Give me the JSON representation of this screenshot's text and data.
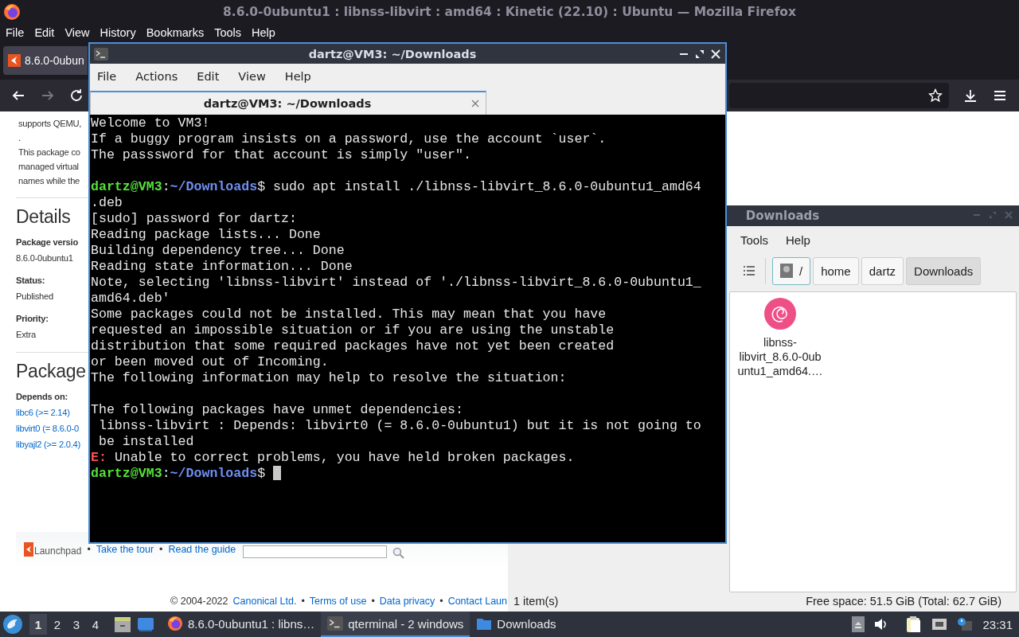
{
  "firefox": {
    "title": "8.6.0-0ubuntu1 : libnss-libvirt : amd64 : Kinetic (22.10) : Ubuntu — Mozilla Firefox",
    "menu": [
      "File",
      "Edit",
      "View",
      "History",
      "Bookmarks",
      "Tools",
      "Help"
    ],
    "tabs": [
      {
        "label": "8.6.0-0ubun",
        "selected": true
      }
    ],
    "page": {
      "intro": [
        "supports QEMU,",
        ".",
        "This package co",
        "managed virtual",
        "names while the"
      ],
      "details_heading": "Details",
      "details": [
        {
          "label": "Package versio",
          "value": "8.6.0-0ubuntu1"
        },
        {
          "label": "Status:",
          "value": "Published"
        },
        {
          "label": "Priority:",
          "value": "Extra"
        }
      ],
      "package_heading": "Package",
      "depends_label": "Depends on:",
      "depends": [
        "libc6 (>= 2.14)",
        "libvirt0 (= 8.6.0-0",
        "libyajl2 (>= 2.0.4)"
      ],
      "brand": "Launchpad",
      "separator": "•",
      "tour_links": [
        "Take the tour",
        "Read the guide"
      ],
      "copyright": "© 2004-2022",
      "footer_links": [
        "Canonical Ltd.",
        "Terms of use",
        "Data privacy",
        "Contact Laun"
      ]
    }
  },
  "file_manager": {
    "title": "Downloads",
    "menu": [
      "Tools",
      "Help"
    ],
    "path": [
      {
        "label": "/",
        "kind": "root",
        "selected": false
      },
      {
        "label": "home",
        "kind": "folder",
        "selected": false
      },
      {
        "label": "dartz",
        "kind": "folder",
        "selected": false
      },
      {
        "label": "Downloads",
        "kind": "folder",
        "selected": true
      }
    ],
    "files": [
      {
        "name_lines": [
          "libnss-",
          "libvirt_8.6.0-0ub",
          "untu1_amd64.…"
        ]
      }
    ],
    "status": "1 item(s)",
    "free_space": "Free space: 51.5 GiB (Total: 62.7 GiB)"
  },
  "terminal": {
    "title": "dartz@VM3: ~/Downloads",
    "menu": [
      "File",
      "Actions",
      "Edit",
      "View",
      "Help"
    ],
    "tabs": [
      {
        "label": "dartz@VM3: ~/Downloads",
        "selected": true
      }
    ],
    "lines": [
      {
        "kind": "text",
        "segments": [
          {
            "kind": "plain",
            "text": "Welcome to VM3!"
          }
        ]
      },
      {
        "kind": "text",
        "segments": [
          {
            "kind": "plain",
            "text": "If a buggy program insists on a password, use the account `user`."
          }
        ]
      },
      {
        "kind": "text",
        "segments": [
          {
            "kind": "plain",
            "text": "The passsword for that account is simply \"user\"."
          }
        ]
      },
      {
        "kind": "blank"
      },
      {
        "kind": "text",
        "segments": [
          {
            "kind": "user",
            "text": "dartz@VM3"
          },
          {
            "kind": "plain",
            "text": ":"
          },
          {
            "kind": "path",
            "text": "~/Downloads"
          },
          {
            "kind": "plain",
            "text": "$ sudo apt install ./libnss-libvirt_8.6.0-0ubuntu1_amd64"
          }
        ]
      },
      {
        "kind": "text",
        "segments": [
          {
            "kind": "plain",
            "text": ".deb"
          }
        ]
      },
      {
        "kind": "text",
        "segments": [
          {
            "kind": "plain",
            "text": "[sudo] password for dartz:"
          }
        ]
      },
      {
        "kind": "text",
        "segments": [
          {
            "kind": "plain",
            "text": "Reading package lists... Done"
          }
        ]
      },
      {
        "kind": "text",
        "segments": [
          {
            "kind": "plain",
            "text": "Building dependency tree... Done"
          }
        ]
      },
      {
        "kind": "text",
        "segments": [
          {
            "kind": "plain",
            "text": "Reading state information... Done"
          }
        ]
      },
      {
        "kind": "text",
        "segments": [
          {
            "kind": "plain",
            "text": "Note, selecting 'libnss-libvirt' instead of './libnss-libvirt_8.6.0-0ubuntu1_"
          }
        ]
      },
      {
        "kind": "text",
        "segments": [
          {
            "kind": "plain",
            "text": "amd64.deb'"
          }
        ]
      },
      {
        "kind": "text",
        "segments": [
          {
            "kind": "plain",
            "text": "Some packages could not be installed. This may mean that you have"
          }
        ]
      },
      {
        "kind": "text",
        "segments": [
          {
            "kind": "plain",
            "text": "requested an impossible situation or if you are using the unstable"
          }
        ]
      },
      {
        "kind": "text",
        "segments": [
          {
            "kind": "plain",
            "text": "distribution that some required packages have not yet been created"
          }
        ]
      },
      {
        "kind": "text",
        "segments": [
          {
            "kind": "plain",
            "text": "or been moved out of Incoming."
          }
        ]
      },
      {
        "kind": "text",
        "segments": [
          {
            "kind": "plain",
            "text": "The following information may help to resolve the situation:"
          }
        ]
      },
      {
        "kind": "blank"
      },
      {
        "kind": "text",
        "segments": [
          {
            "kind": "plain",
            "text": "The following packages have unmet dependencies:"
          }
        ]
      },
      {
        "kind": "text",
        "segments": [
          {
            "kind": "plain",
            "text": " libnss-libvirt : Depends: libvirt0 (= 8.6.0-0ubuntu1) but it is not going to"
          }
        ]
      },
      {
        "kind": "text",
        "segments": [
          {
            "kind": "plain",
            "text": " be installed"
          }
        ]
      },
      {
        "kind": "text",
        "segments": [
          {
            "kind": "error",
            "text": "E:"
          },
          {
            "kind": "plain",
            "text": " Unable to correct problems, you have held broken packages."
          }
        ]
      },
      {
        "kind": "prompt",
        "cursor": true,
        "segments": [
          {
            "kind": "user",
            "text": "dartz@VM3"
          },
          {
            "kind": "plain",
            "text": ":"
          },
          {
            "kind": "path",
            "text": "~/Downloads"
          },
          {
            "kind": "plain",
            "text": "$"
          }
        ]
      }
    ]
  },
  "taskbar": {
    "workspaces": [
      {
        "label": "1",
        "selected": true
      },
      {
        "label": "2",
        "selected": false
      },
      {
        "label": "3",
        "selected": false
      },
      {
        "label": "4",
        "selected": false
      }
    ],
    "tasks": [
      {
        "kind": "browser",
        "label": "8.6.0-0ubuntu1 : libns…",
        "selected": false
      },
      {
        "kind": "terminal",
        "label": "qterminal - 2 windows",
        "selected": true
      },
      {
        "kind": "folder",
        "label": "Downloads",
        "selected": false
      }
    ],
    "clock": "23:31"
  }
}
